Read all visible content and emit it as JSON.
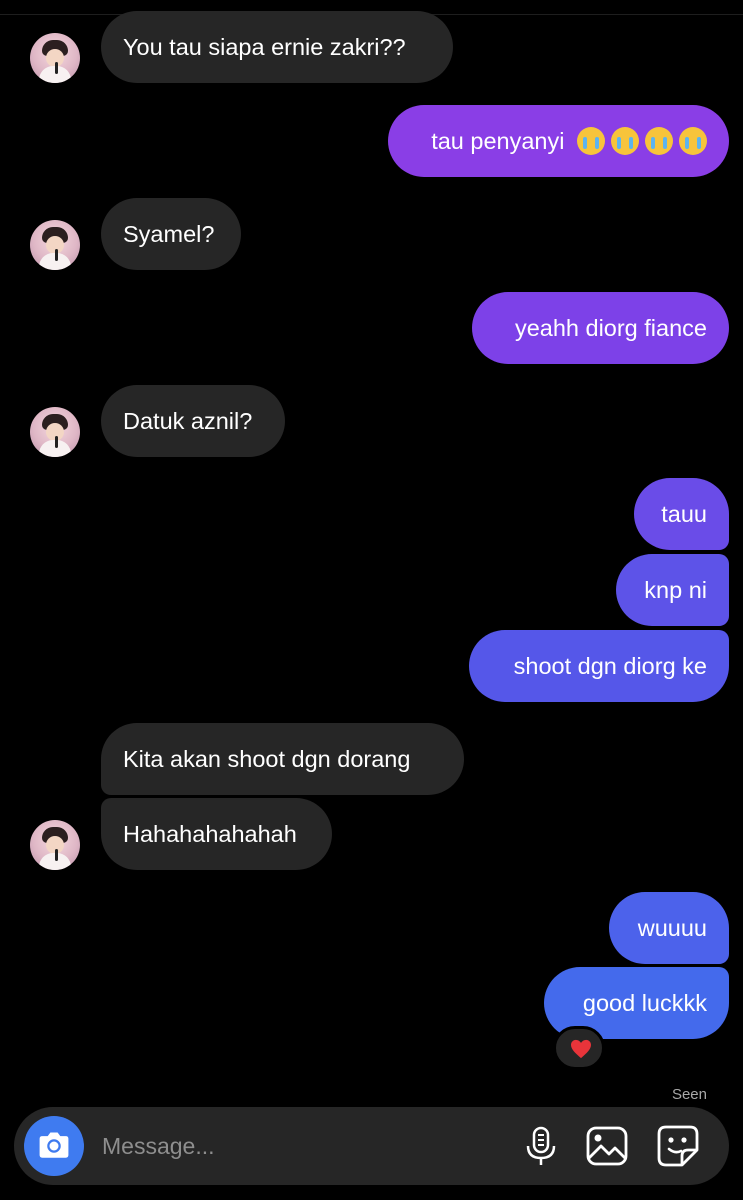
{
  "messages": [
    {
      "from": "them",
      "text": "You tau siapa ernie zakri??"
    },
    {
      "from": "me",
      "text": "tau penyanyi",
      "emoji_count": 4,
      "emoji": "loudly-crying-face"
    },
    {
      "from": "them",
      "text": "Syamel?"
    },
    {
      "from": "me",
      "text": "yeahh diorg fiance"
    },
    {
      "from": "them",
      "text": "Datuk aznil?"
    },
    {
      "from": "me",
      "text": "tauu"
    },
    {
      "from": "me",
      "text": "knp ni"
    },
    {
      "from": "me",
      "text": "shoot dgn diorg ke"
    },
    {
      "from": "them",
      "text": "Kita akan shoot dgn dorang"
    },
    {
      "from": "them",
      "text": "Hahahahahahah"
    },
    {
      "from": "me",
      "text": "wuuuu"
    },
    {
      "from": "me",
      "text": "good luckkk",
      "reaction": "heart"
    }
  ],
  "status": {
    "seen": "Seen"
  },
  "composer": {
    "placeholder": "Message..."
  },
  "icons": [
    "camera-icon",
    "microphone-icon",
    "gallery-icon",
    "sticker-icon"
  ],
  "colors": {
    "background": "#000000",
    "incoming_bubble": "#262626",
    "outgoing_gradient_top": "#8a3ee6",
    "outgoing_gradient_bottom": "#3f6ded",
    "camera_button": "#3f7bf0",
    "composer_bg": "#262626"
  }
}
